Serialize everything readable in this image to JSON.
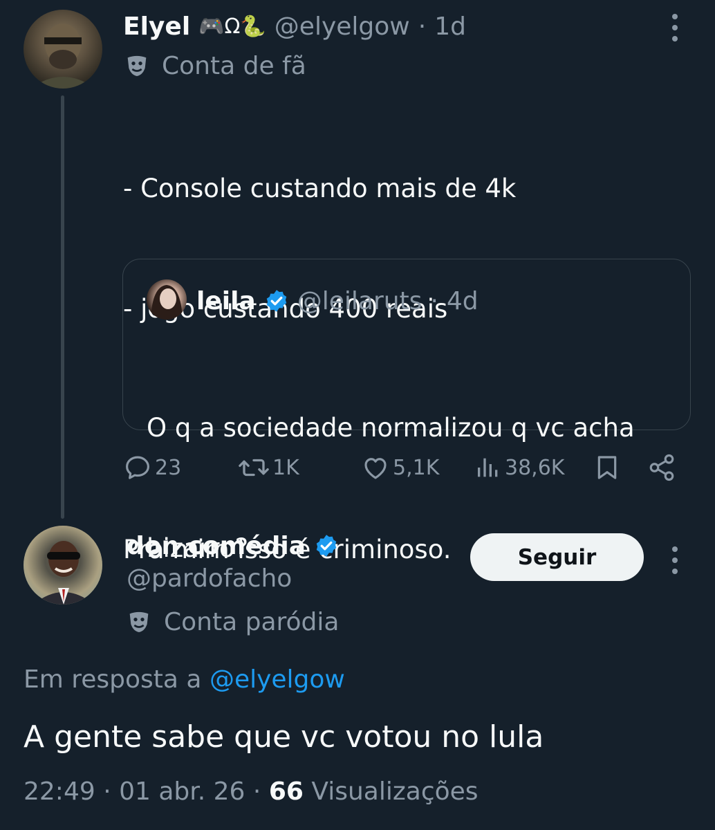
{
  "original_tweet": {
    "author_name": "Elyel",
    "author_emojis": "🎮Ω🐍",
    "handle": "@elyelgow",
    "separator": "·",
    "time": "1d",
    "account_label": "Conta de fã",
    "text_lines": [
      "- Console custando mais de 4k",
      "- jogo custando 400 reais",
      "",
      "Pra mim isso é criminoso."
    ]
  },
  "quoted_tweet": {
    "author_name": "leila",
    "handle": "@leilaruts",
    "separator": "·",
    "time": "4d",
    "text_lines": [
      "O q a sociedade normalizou q vc acha",
      "bizarro?"
    ]
  },
  "actions": {
    "replies": "23",
    "retweets": "1K",
    "likes": "5,1K",
    "views": "38,6K"
  },
  "reply": {
    "author_name": "don comédia",
    "handle": "@pardofacho",
    "account_label": "Conta paródia",
    "follow_label": "Seguir",
    "in_reply_prefix": "Em resposta a",
    "in_reply_handle": "@elyelgow",
    "text": "A gente sabe que vc votou no lula",
    "time": "22:49",
    "date": "01 abr. 26",
    "separator": "·",
    "view_count": "66",
    "view_label": "Visualizações"
  },
  "colors": {
    "background": "#15202b",
    "text_primary": "#f7f9f9",
    "text_muted": "#8b98a5",
    "link": "#1d9bf0",
    "verified": "#1d9bf0",
    "border": "#38444d"
  }
}
